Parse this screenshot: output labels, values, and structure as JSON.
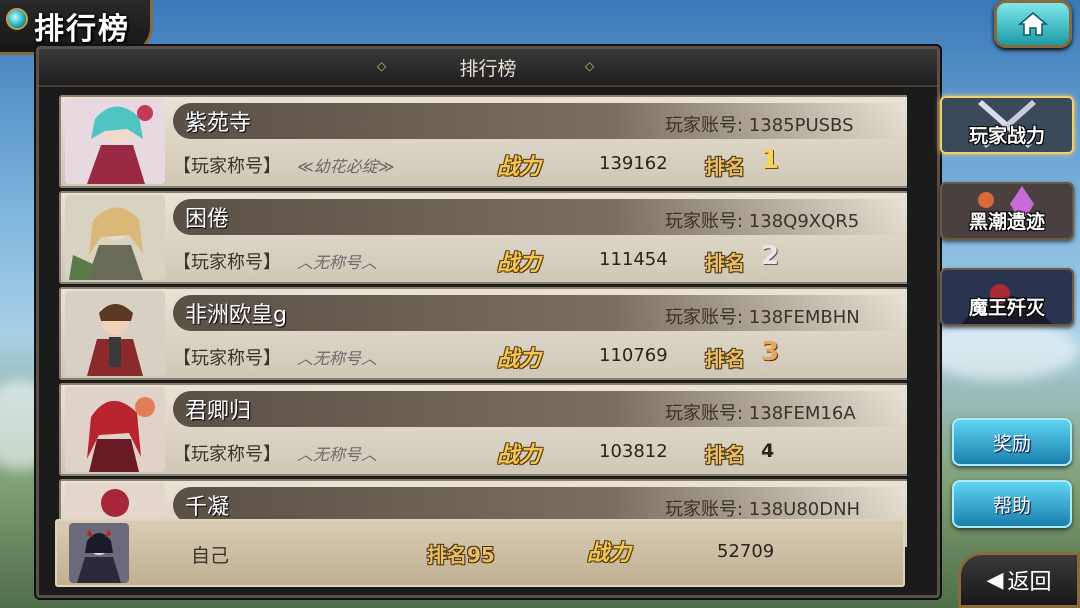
{
  "screen_title": "排行榜",
  "panel_title": "排行榜",
  "labels": {
    "account_prefix": "玩家账号: ",
    "title_bracket": "【玩家称号】",
    "power": "战力",
    "rank": "排名"
  },
  "entries": [
    {
      "name": "紫苑寺",
      "account": "1385PUSBS",
      "title": "幼花必绽",
      "power": "139162",
      "rank": "1"
    },
    {
      "name": "困倦",
      "account": "138Q9XQR5",
      "title": "无称号",
      "power": "111454",
      "rank": "2"
    },
    {
      "name": "非洲欧皇g",
      "account": "138FEMBHN",
      "title": "无称号",
      "power": "110769",
      "rank": "3"
    },
    {
      "name": "君卿归",
      "account": "138FEM16A",
      "title": "无称号",
      "power": "103812",
      "rank": "4"
    },
    {
      "name": "千凝",
      "account": "138U80DNH",
      "title": "",
      "power": "",
      "rank": ""
    }
  ],
  "self": {
    "name": "自己",
    "rank_text": "排名95",
    "power_label": "战力",
    "power": "52709"
  },
  "side_tabs": [
    {
      "label": "玩家战力",
      "active": true
    },
    {
      "label": "黑潮遗迹",
      "active": false
    },
    {
      "label": "魔王歼灭",
      "active": false
    }
  ],
  "buttons": {
    "reward": "奖励",
    "help": "帮助",
    "back": "返回"
  },
  "icons": {
    "home": "home-icon",
    "back": "back-arrow-icon"
  }
}
